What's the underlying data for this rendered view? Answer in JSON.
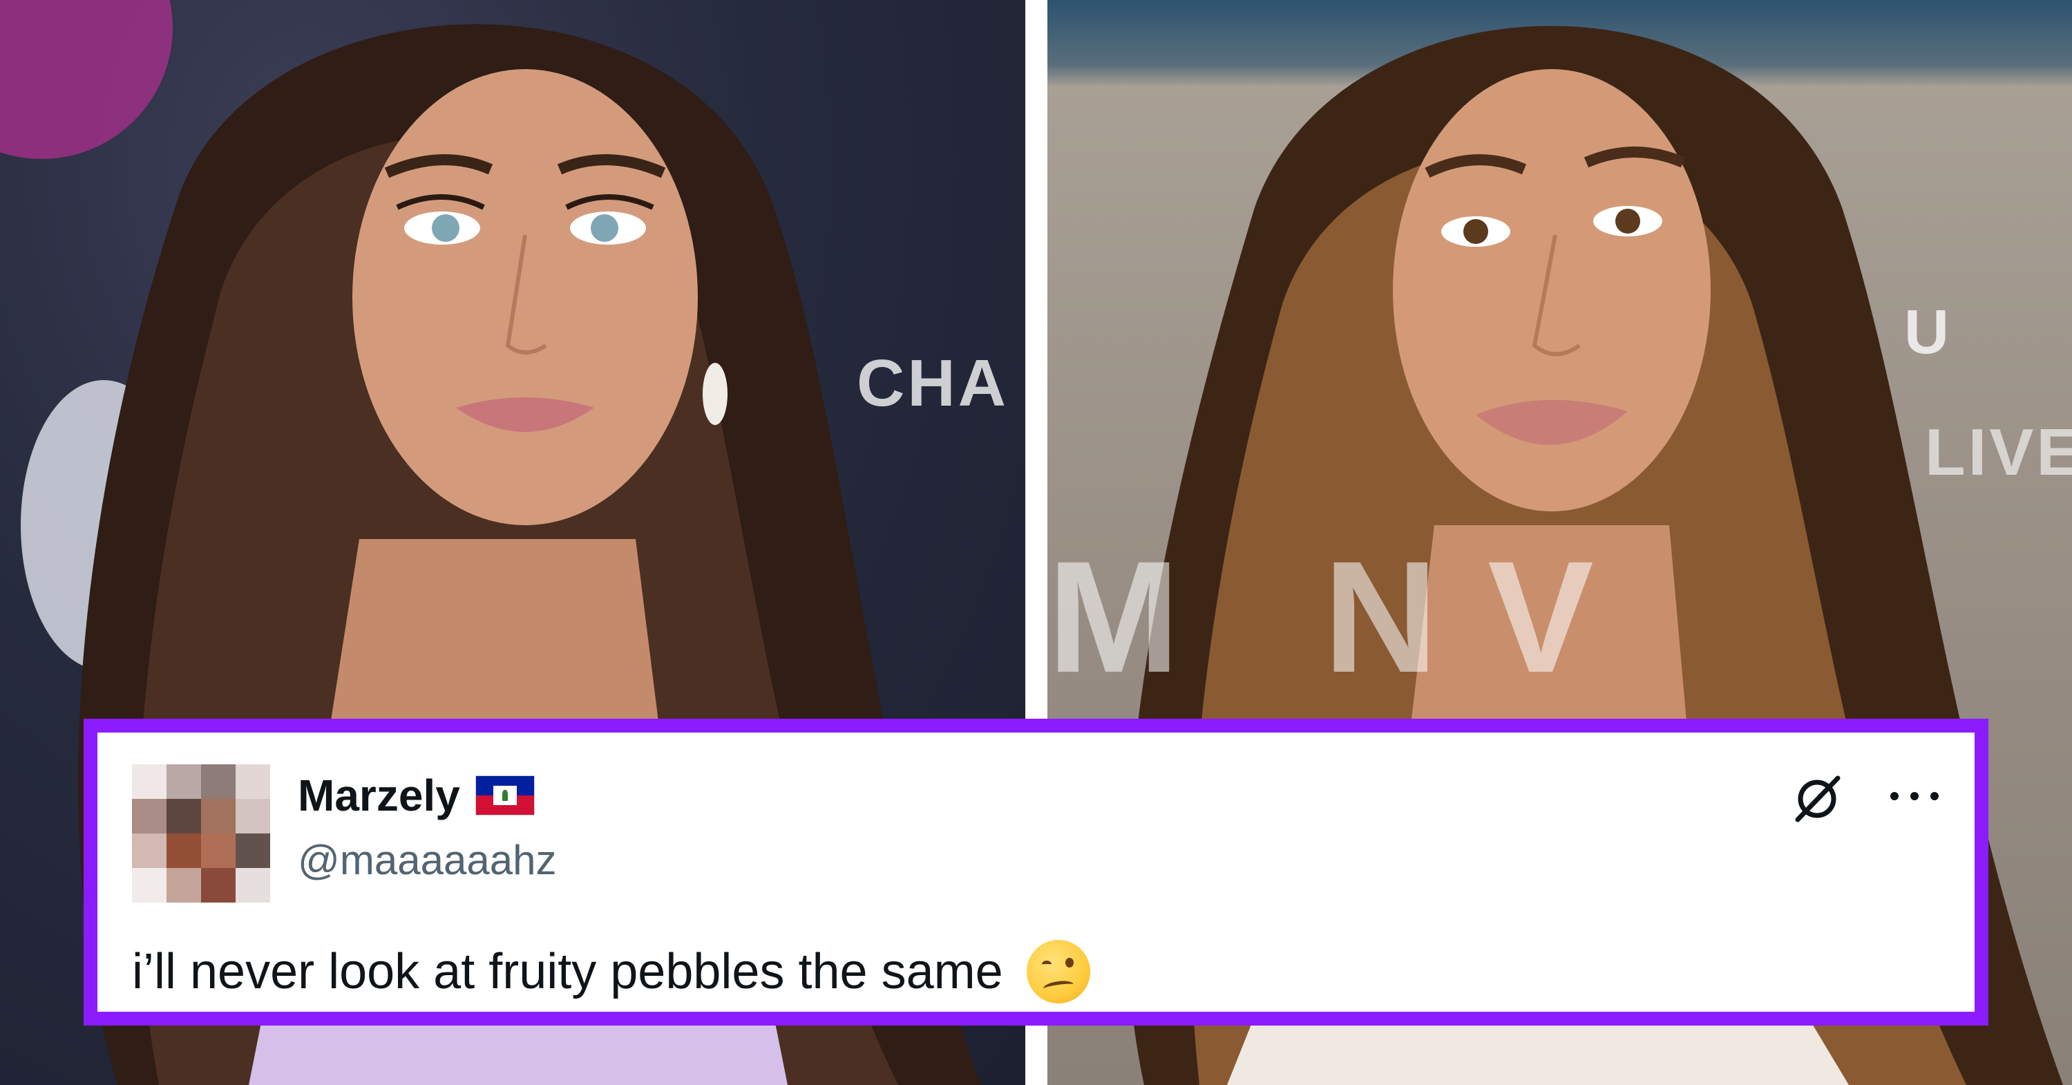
{
  "background": {
    "left_sign_text": "CHA",
    "right_sign_text_1": "U",
    "right_sign_text_2": "LIVE",
    "right_sign_text_3": "M   N V"
  },
  "tweet": {
    "display_name": "Marzely",
    "flag_icon": "haiti-flag-icon",
    "handle": "@maaaaaahz",
    "text": "i’ll never look at fruity pebbles the same",
    "emoji_icon": "woozy-face-icon",
    "border_color": "#8a1cff",
    "grok_icon": "grok-slash-icon",
    "more_icon": "more-options-icon"
  }
}
